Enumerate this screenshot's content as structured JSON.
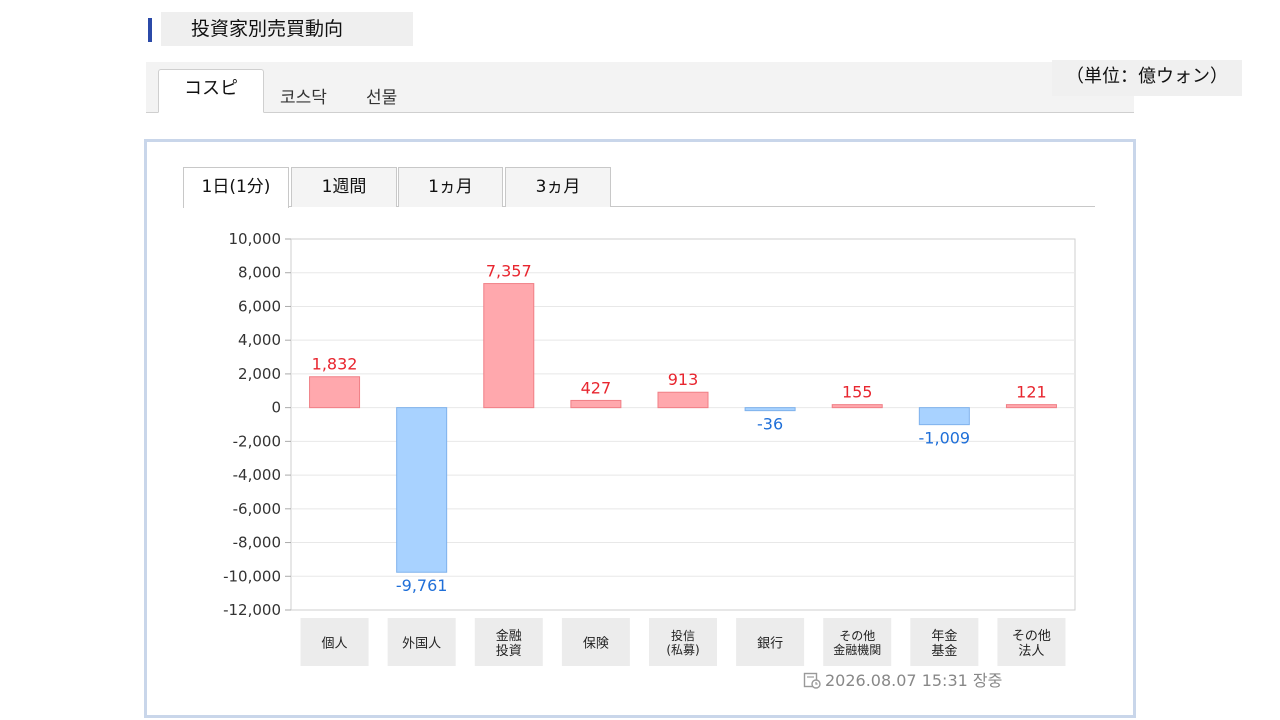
{
  "header": {
    "title": "投資家別売買動向"
  },
  "market_tabs": [
    {
      "label": "コスピ",
      "active": true
    },
    {
      "label": "코스닥",
      "active": false
    },
    {
      "label": "선물",
      "active": false
    }
  ],
  "unit_label": "（単位：億ウォン）",
  "period_tabs": [
    {
      "label": "1日(1分)",
      "active": true
    },
    {
      "label": "1週間",
      "active": false
    },
    {
      "label": "1ヵ月",
      "active": false
    },
    {
      "label": "3ヵ月",
      "active": false
    }
  ],
  "timestamp": "2026.08.07 15:31 장중",
  "colors": {
    "positive_fill": "#ffa8ad",
    "positive_stroke": "#f07f86",
    "positive_text": "#e8262f",
    "negative_fill": "#a8d2ff",
    "negative_stroke": "#7fb2ec",
    "negative_text": "#1f6fd8"
  },
  "chart_data": {
    "type": "bar",
    "title": "",
    "xlabel": "",
    "ylabel": "",
    "ylim": [
      -12000,
      10000
    ],
    "yticks": [
      10000,
      8000,
      6000,
      4000,
      2000,
      0,
      -2000,
      -4000,
      -6000,
      -8000,
      -10000,
      -12000
    ],
    "ytick_labels": [
      "10,000",
      "8,000",
      "6,000",
      "4,000",
      "2,000",
      "0",
      "-2,000",
      "-4,000",
      "-6,000",
      "-8,000",
      "-10,000",
      "-12,000"
    ],
    "categories": [
      [
        "個人"
      ],
      [
        "外国人"
      ],
      [
        "金融",
        "投資"
      ],
      [
        "保険"
      ],
      [
        "投信",
        "(私募)"
      ],
      [
        "銀行"
      ],
      [
        "その他",
        "金融機関"
      ],
      [
        "年金",
        "基金"
      ],
      [
        "その他",
        "法人"
      ]
    ],
    "values": [
      1832,
      -9761,
      7357,
      427,
      913,
      -36,
      155,
      -1009,
      121
    ],
    "value_labels": [
      "1,832",
      "-9,761",
      "7,357",
      "427",
      "913",
      "-36",
      "155",
      "-1,009",
      "121"
    ],
    "grid": true
  }
}
